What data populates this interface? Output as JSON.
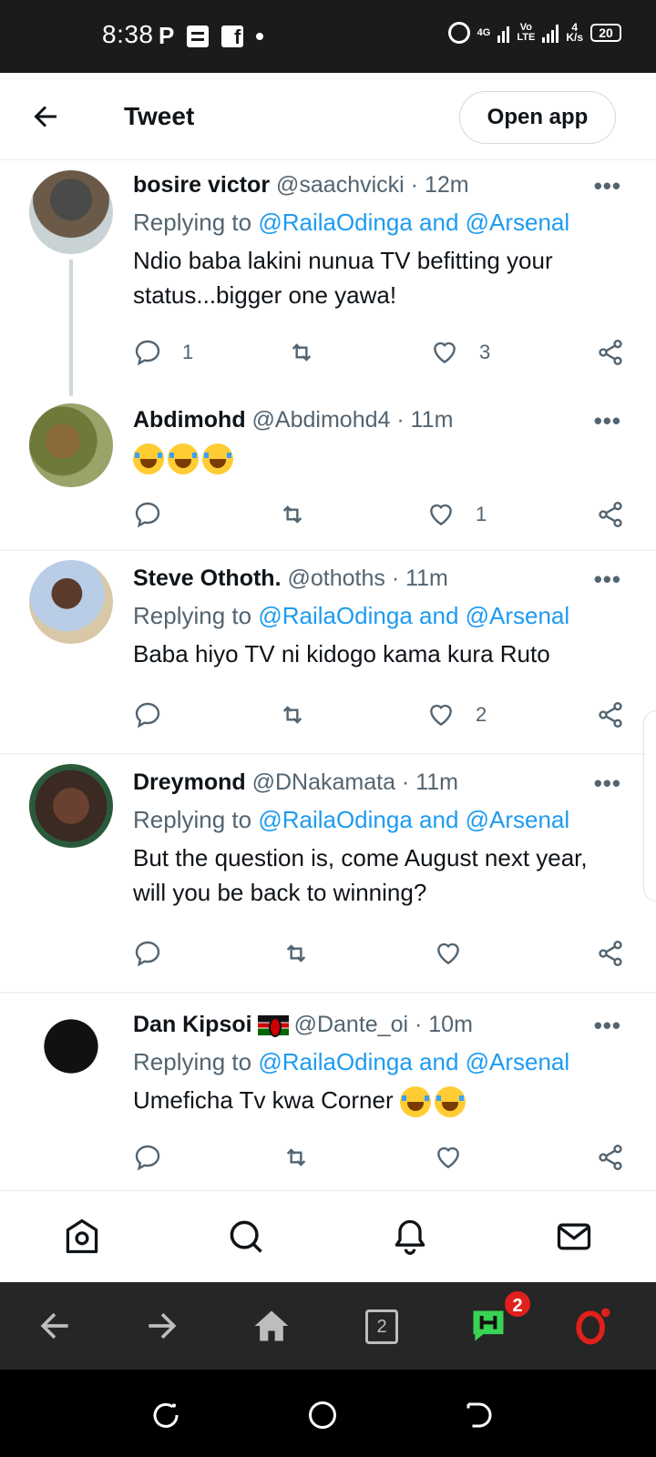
{
  "status_bar": {
    "time": "8:38",
    "net_speed": "4\nK/s",
    "battery": "20",
    "network": "4G",
    "volte": "Vo\nLTE"
  },
  "header": {
    "title": "Tweet",
    "open_app_label": "Open app"
  },
  "tweets": [
    {
      "name": "bosire victor",
      "handle": "@saachvicki",
      "time": "· 12m",
      "replying_prefix": "Replying to ",
      "replying_mentions": "@RailaOdinga and @Arsenal",
      "text": "Ndio baba lakini nunua TV befitting your status...bigger one yawa!",
      "replies": "1",
      "retweets": "",
      "likes": "3"
    },
    {
      "name": "Abdimohd",
      "handle": "@Abdimohd4",
      "time": "· 11m",
      "text": "😂😂😂",
      "replies": "",
      "retweets": "",
      "likes": "1"
    },
    {
      "name": "Steve Othoth.",
      "handle": "@othoths",
      "time": "· 11m",
      "replying_prefix": "Replying to ",
      "replying_mentions": "@RailaOdinga and @Arsenal",
      "text": "Baba hiyo TV ni kidogo kama kura Ruto",
      "replies": "",
      "retweets": "",
      "likes": "2"
    },
    {
      "name": "Dreymond",
      "handle": "@DNakamata",
      "time": "· 11m",
      "replying_prefix": "Replying to ",
      "replying_mentions": "@RailaOdinga and @Arsenal",
      "text": "But the question is, come August next year, will you be back to winning?",
      "replies": "",
      "retweets": "",
      "likes": ""
    },
    {
      "name": "Dan Kipsoi",
      "handle": "@Dante_oi",
      "time": "· 10m",
      "replying_prefix": "Replying to ",
      "replying_mentions": "@RailaOdinga and @Arsenal",
      "text": "Umeficha Tv kwa Corner",
      "replies": "",
      "retweets": "",
      "likes": ""
    }
  ],
  "more_label": "•••",
  "browser": {
    "tabs_count": "2",
    "notif_badge": "2"
  },
  "colors": {
    "mention": "#1d9bf0",
    "secondary_text": "#536471",
    "browser_bar": "#262626",
    "opera_red": "#e0201b"
  }
}
